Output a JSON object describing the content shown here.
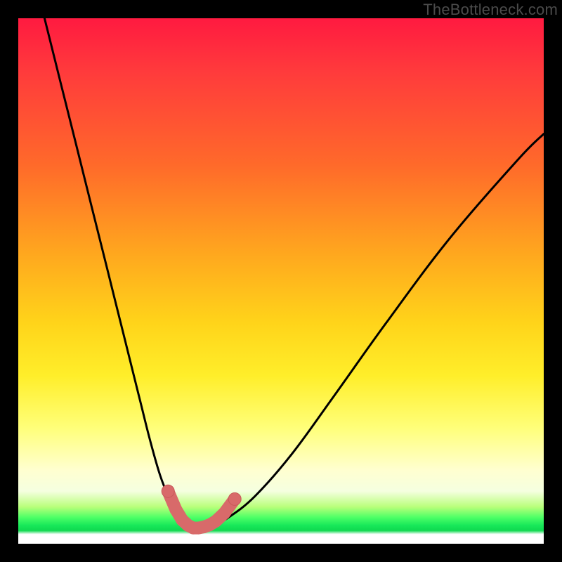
{
  "watermark": {
    "text": "TheBottleneck.com"
  },
  "colors": {
    "frame": "#000000",
    "curve": "#000000",
    "marker_fill": "#d86a6a",
    "marker_stroke": "#c85a5a",
    "gradient_top": "#ff1a40",
    "gradient_mid": "#ffd41a",
    "gradient_green": "#18e85a"
  },
  "chart_data": {
    "type": "line",
    "title": "",
    "xlabel": "",
    "ylabel": "",
    "xlim": [
      0,
      100
    ],
    "ylim": [
      0,
      100
    ],
    "grid": false,
    "legend": false,
    "series": [
      {
        "name": "bottleneck-curve",
        "x": [
          5,
          8,
          11,
          14,
          17,
          20,
          23,
          25,
          27,
          29,
          30.5,
          32,
          33.5,
          35,
          37,
          40,
          45,
          52,
          60,
          70,
          82,
          95,
          100
        ],
        "y": [
          100,
          88,
          76,
          64,
          52,
          40,
          28,
          20,
          13,
          8,
          5,
          3.5,
          3,
          3,
          3.5,
          5,
          9,
          17,
          28,
          42,
          58,
          73,
          78
        ],
        "type": "line"
      },
      {
        "name": "optimal-range-markers",
        "x": [
          28.5,
          30.0,
          31.2,
          32.3,
          33.3,
          34.3,
          35.3,
          36.4,
          37.6,
          39.2,
          41.2
        ],
        "y": [
          10.0,
          6.5,
          4.5,
          3.5,
          3.0,
          3.0,
          3.2,
          3.6,
          4.3,
          5.8,
          8.5
        ],
        "type": "scatter"
      }
    ],
    "annotations": []
  }
}
